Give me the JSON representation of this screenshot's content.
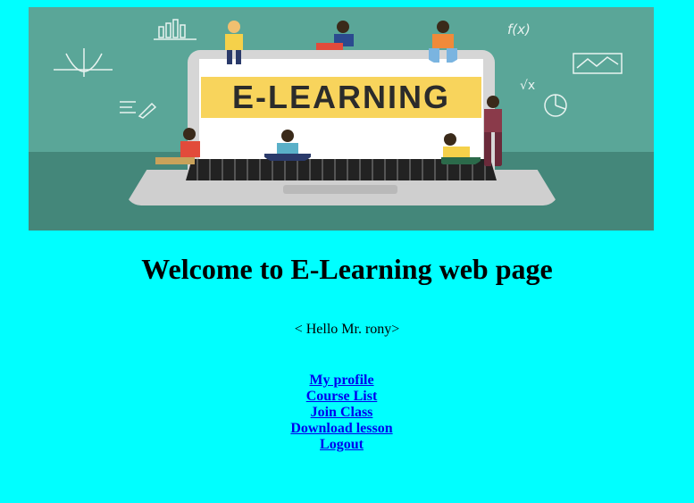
{
  "banner": {
    "image_text": "E-LEARNING",
    "doodles": {
      "fx": "f(x)",
      "sqrt": "√x"
    }
  },
  "page": {
    "heading": "Welcome to E-Learning web page",
    "greeting": "< Hello Mr. rony>"
  },
  "menu": {
    "items": [
      {
        "label": "My profile"
      },
      {
        "label": "Course List"
      },
      {
        "label": "Join Class"
      },
      {
        "label": "Download lesson"
      },
      {
        "label": "Logout"
      }
    ]
  },
  "colors": {
    "page_background": "#00ffff",
    "banner_background": "#5aa698",
    "banner_title_band": "#f8d45c",
    "link": "#0000ee"
  }
}
